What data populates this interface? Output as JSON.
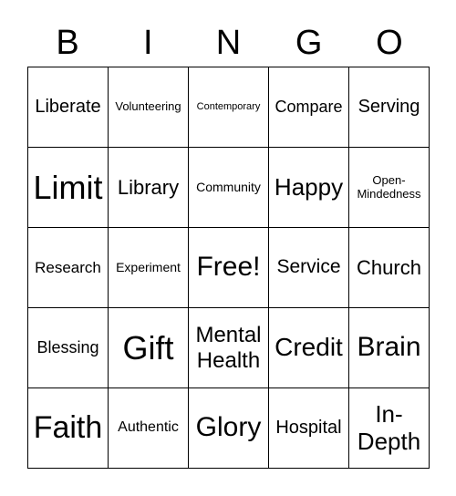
{
  "header": [
    "B",
    "I",
    "N",
    "G",
    "O"
  ],
  "cells": [
    {
      "text": "Liberate",
      "size": 20
    },
    {
      "text": "Volunteering",
      "size": 13
    },
    {
      "text": "Contemporary",
      "size": 11
    },
    {
      "text": "Compare",
      "size": 18
    },
    {
      "text": "Serving",
      "size": 20
    },
    {
      "text": "Limit",
      "size": 36
    },
    {
      "text": "Library",
      "size": 22
    },
    {
      "text": "Community",
      "size": 14
    },
    {
      "text": "Happy",
      "size": 26
    },
    {
      "text": "Open-Mindedness",
      "size": 13
    },
    {
      "text": "Research",
      "size": 17
    },
    {
      "text": "Experiment",
      "size": 14
    },
    {
      "text": "Free!",
      "size": 30
    },
    {
      "text": "Service",
      "size": 21
    },
    {
      "text": "Church",
      "size": 22
    },
    {
      "text": "Blessing",
      "size": 18
    },
    {
      "text": "Gift",
      "size": 36
    },
    {
      "text": "Mental Health",
      "size": 24
    },
    {
      "text": "Credit",
      "size": 28
    },
    {
      "text": "Brain",
      "size": 30
    },
    {
      "text": "Faith",
      "size": 34
    },
    {
      "text": "Authentic",
      "size": 16
    },
    {
      "text": "Glory",
      "size": 30
    },
    {
      "text": "Hospital",
      "size": 20
    },
    {
      "text": "In-Depth",
      "size": 26
    }
  ]
}
